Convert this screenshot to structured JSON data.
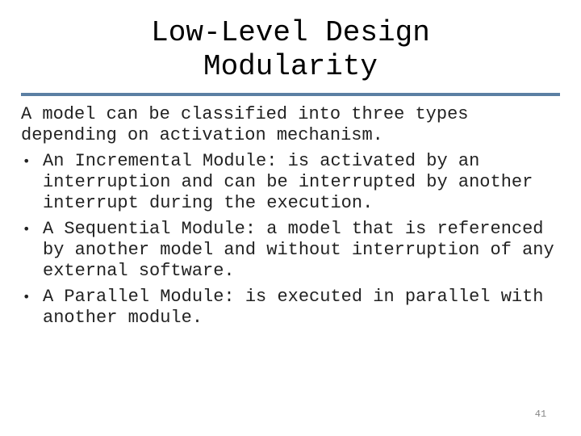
{
  "slide": {
    "title_lines": [
      "Low-Level Design",
      "Modularity"
    ],
    "intro": "A model can be classified into three types depending on activation mechanism.",
    "bullet_glyph": "•",
    "bullets": [
      "An Incremental Module: is activated by an interruption and can be interrupted by another interrupt during the execution.",
      "A Sequential Module: a model that is referenced by another model and without interruption of any external software.",
      "A Parallel Module: is executed in parallel with another module."
    ],
    "page_number": "41",
    "colors": {
      "rule": "#5b7fa3",
      "text": "#222222"
    }
  }
}
